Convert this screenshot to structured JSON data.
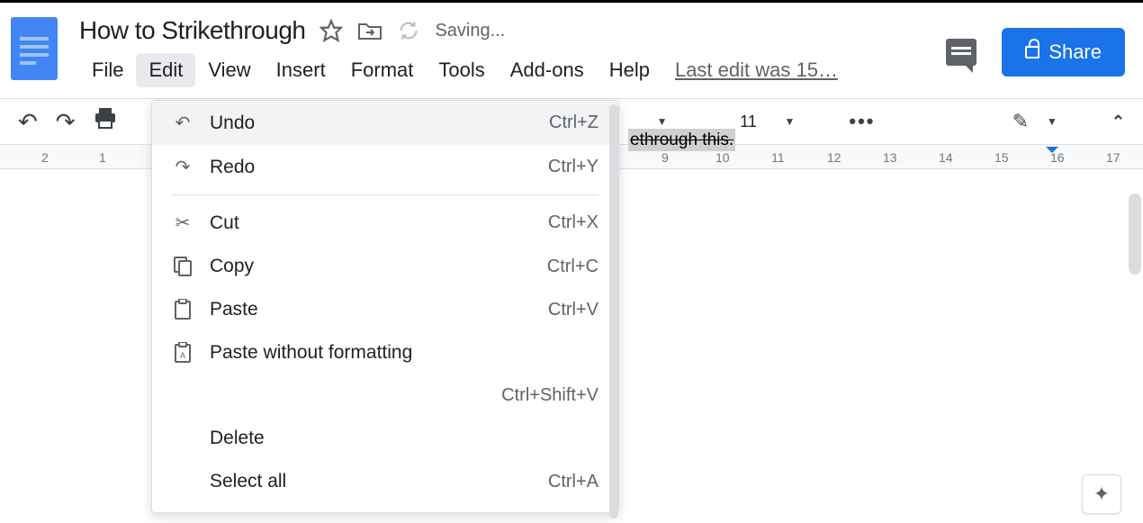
{
  "header": {
    "doc_title": "How to Strikethrough",
    "saving_status": "Saving...",
    "share_label": "Share",
    "last_edit": "Last edit was 15…"
  },
  "menubar": {
    "items": [
      "File",
      "Edit",
      "View",
      "Insert",
      "Format",
      "Tools",
      "Add-ons",
      "Help"
    ]
  },
  "toolbar": {
    "font_size": "11"
  },
  "ruler": {
    "left_marks": [
      "2",
      "1"
    ],
    "right_marks": [
      "9",
      "10",
      "11",
      "12",
      "13",
      "14",
      "15",
      "16",
      "17"
    ]
  },
  "edit_menu": {
    "items": [
      {
        "icon": "↶",
        "label": "Undo",
        "shortcut": "Ctrl+Z",
        "hover": true
      },
      {
        "icon": "↷",
        "label": "Redo",
        "shortcut": "Ctrl+Y"
      },
      {
        "divider": true
      },
      {
        "icon": "✂",
        "label": "Cut",
        "shortcut": "Ctrl+X"
      },
      {
        "icon": "⧉",
        "label": "Copy",
        "shortcut": "Ctrl+C"
      },
      {
        "icon": "📋",
        "label": "Paste",
        "shortcut": "Ctrl+V"
      },
      {
        "icon": "📋",
        "label": "Paste without formatting",
        "shortcut": "Ctrl+Shift+V",
        "wrap": true
      },
      {
        "icon": "",
        "label": "Delete",
        "shortcut": ""
      },
      {
        "icon": "",
        "label": "Select all",
        "shortcut": "Ctrl+A"
      }
    ]
  },
  "document": {
    "visible_text": "ethrough this."
  }
}
